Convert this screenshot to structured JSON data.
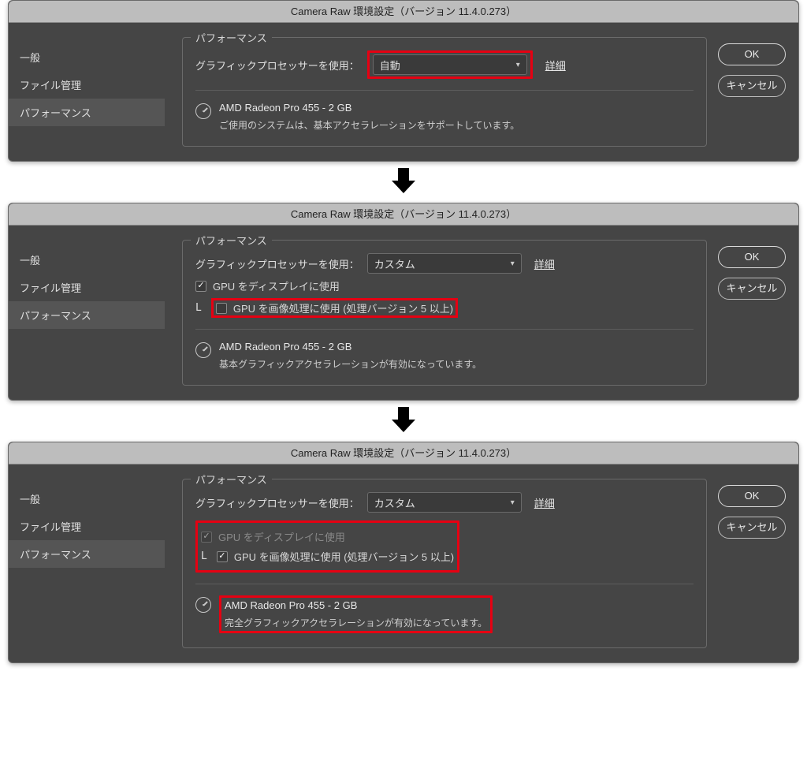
{
  "dialogs": [
    {
      "title": "Camera Raw 環境設定（バージョン 11.4.0.273）",
      "sidebar": [
        "一般",
        "ファイル管理",
        "パフォーマンス"
      ],
      "activeIdx": 2,
      "legend": "パフォーマンス",
      "gpuLabel": "グラフィックプロセッサーを使用：",
      "select": "自動",
      "selectHighlight": true,
      "detailsLink": "詳細",
      "checkboxes": [],
      "gpuName": "AMD Radeon Pro 455 - 2 GB",
      "gpuDesc": "ご使用のシステムは、基本アクセラレーションをサポートしています。",
      "gpuHighlight": false,
      "buttons": {
        "ok": "OK",
        "cancel": "キャンセル"
      }
    },
    {
      "title": "Camera Raw 環境設定（バージョン 11.4.0.273）",
      "sidebar": [
        "一般",
        "ファイル管理",
        "パフォーマンス"
      ],
      "activeIdx": 2,
      "legend": "パフォーマンス",
      "gpuLabel": "グラフィックプロセッサーを使用：",
      "select": "カスタム",
      "selectHighlight": false,
      "detailsLink": "詳細",
      "checkboxes": [
        {
          "prefix": "",
          "label": "GPU をディスプレイに使用",
          "checked": true,
          "disabled": false,
          "highlight": false
        },
        {
          "prefix": "L",
          "label": "GPU を画像処理に使用 (処理バージョン 5 以上)",
          "checked": false,
          "disabled": false,
          "highlight": true
        }
      ],
      "gpuName": "AMD Radeon Pro 455 - 2 GB",
      "gpuDesc": "基本グラフィックアクセラレーションが有効になっています。",
      "gpuHighlight": false,
      "buttons": {
        "ok": "OK",
        "cancel": "キャンセル"
      }
    },
    {
      "title": "Camera Raw 環境設定（バージョン 11.4.0.273）",
      "sidebar": [
        "一般",
        "ファイル管理",
        "パフォーマンス"
      ],
      "activeIdx": 2,
      "legend": "パフォーマンス",
      "gpuLabel": "グラフィックプロセッサーを使用：",
      "select": "カスタム",
      "selectHighlight": false,
      "detailsLink": "詳細",
      "checkboxes": [
        {
          "prefix": "",
          "label": "GPU をディスプレイに使用",
          "checked": true,
          "disabled": true,
          "highlight": true
        },
        {
          "prefix": "L",
          "label": "GPU を画像処理に使用 (処理バージョン 5 以上)",
          "checked": true,
          "disabled": false,
          "highlight": true
        }
      ],
      "gpuName": "AMD Radeon Pro 455 - 2 GB",
      "gpuDesc": "完全グラフィックアクセラレーションが有効になっています。",
      "gpuHighlight": true,
      "buttons": {
        "ok": "OK",
        "cancel": "キャンセル"
      }
    }
  ]
}
